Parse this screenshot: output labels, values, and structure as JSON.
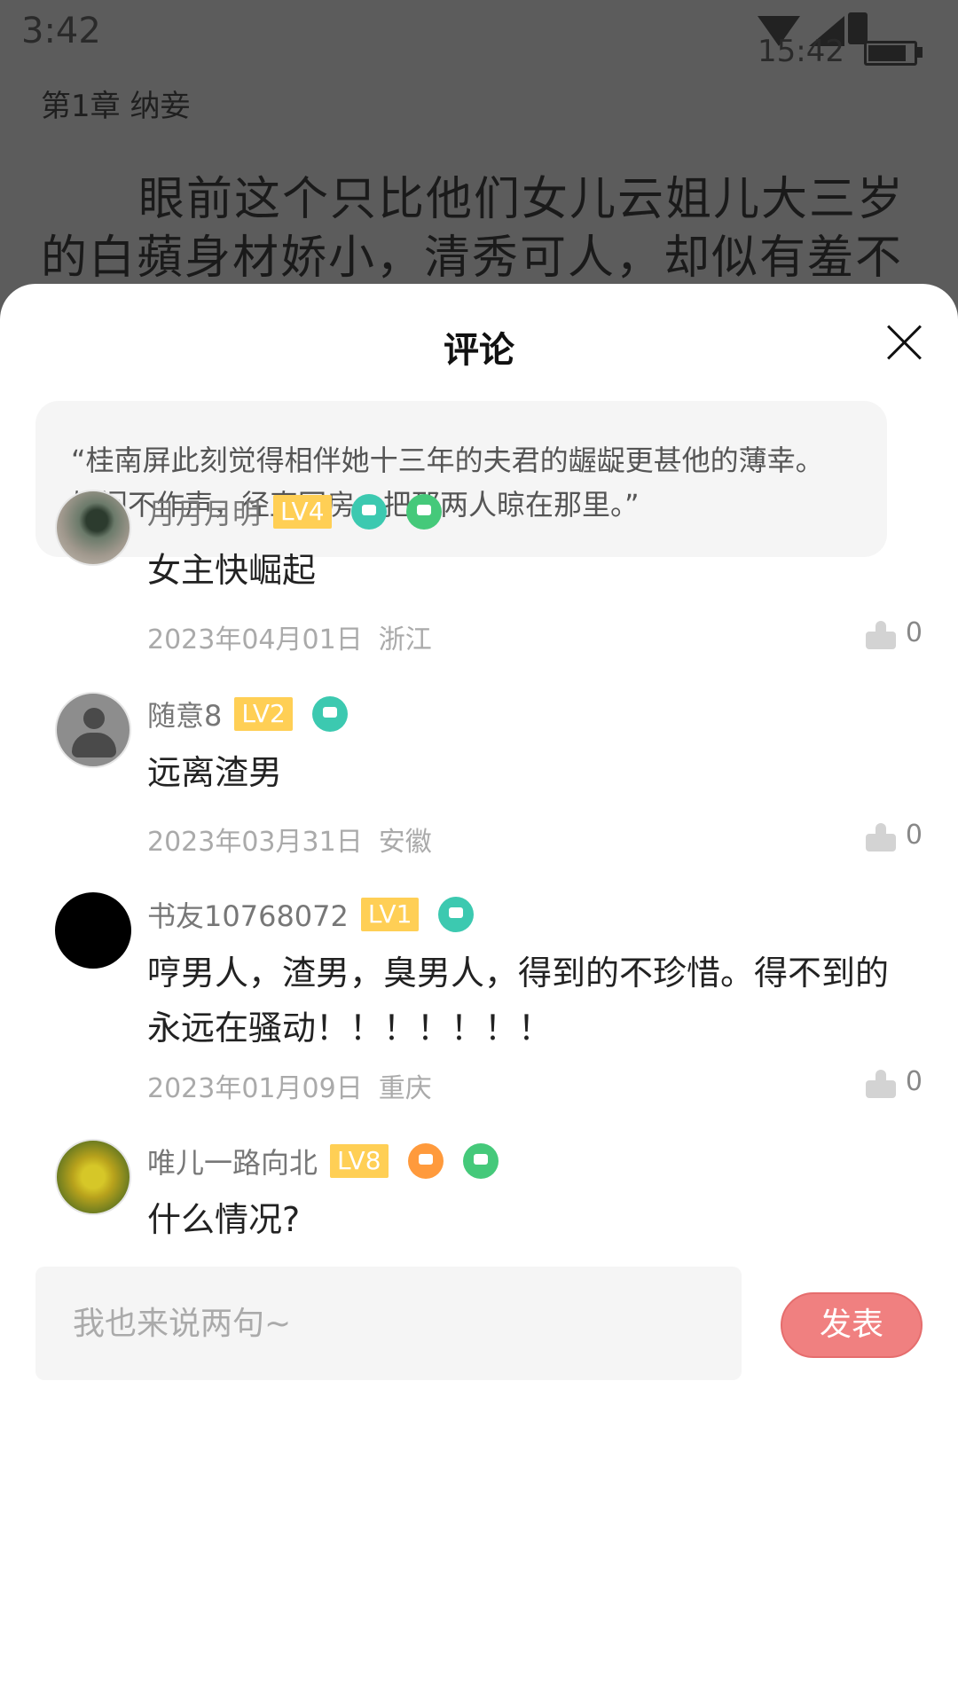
{
  "status_bar": {
    "time_left": "3:42",
    "time_right": "15:42"
  },
  "reader": {
    "chapter_title": "第1章 纳妾",
    "body_text": "眼前这个只比他们女儿云姐儿大三岁的白蘋身材娇小，清秀可人，却似有羞不"
  },
  "sheet": {
    "title": "评论",
    "quote": "“桂南屏此刻觉得相伴她十三年的夫君的龌龊更甚他的薄幸。她闷不作声，径直回房，把那两人晾在那里。”",
    "comments": [
      {
        "nickname": "月月月明",
        "level": "LV4",
        "text": "女主快崛起",
        "date": "2023年04月01日",
        "region": "浙江",
        "likes": "0"
      },
      {
        "nickname": "随意8",
        "level": "LV2",
        "text": "远离渣男",
        "date": "2023年03月31日",
        "region": "安徽",
        "likes": "0"
      },
      {
        "nickname": "书友10768072",
        "level": "LV1",
        "text": "哼男人，渣男，臭男人，得到的不珍惜。得不到的永远在骚动！！！！！！！",
        "date": "2023年01月09日",
        "region": "重庆",
        "likes": "0"
      },
      {
        "nickname": "唯儿一路向北",
        "level": "LV8",
        "text": "什么情况?",
        "date": "",
        "region": "",
        "likes": ""
      }
    ]
  },
  "composer": {
    "placeholder": "我也来说两句~",
    "post_label": "发表"
  },
  "colors": {
    "accent": "#f08080",
    "level_badge": "#ffcf55",
    "quote_bg": "#f5f5f5"
  }
}
